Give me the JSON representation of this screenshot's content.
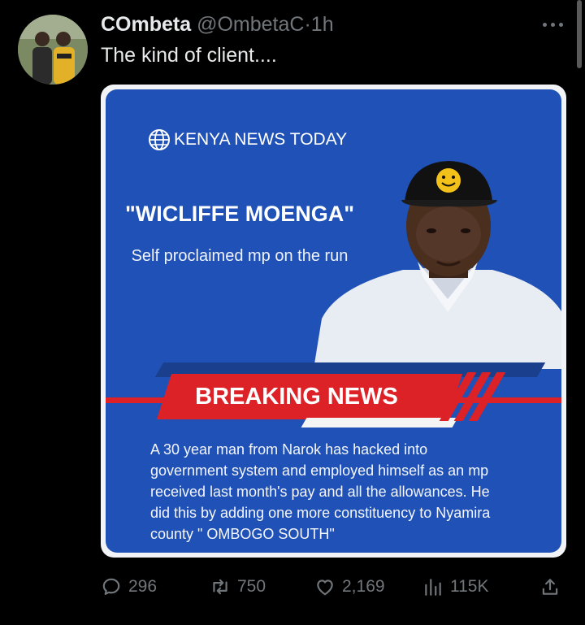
{
  "tweet": {
    "display_name": "COmbeta",
    "handle": "@OmbetaC",
    "separator": "·",
    "time": "1h",
    "text": "The kind of client...."
  },
  "media": {
    "brand": "KENYA NEWS TODAY",
    "headline": "\"WICLIFFE MOENGA\"",
    "subheadline": "Self proclaimed mp on the run",
    "banner": "BREAKING NEWS",
    "body_lines": [
      "A 30 year man from Narok has hacked into",
      "government system and employed himself as an mp",
      "received last month's pay and all the allowances. He",
      "did this by adding one more constituency to Nyamira",
      "county \" OMBOGO SOUTH\""
    ]
  },
  "actions": {
    "replies": "296",
    "reposts": "750",
    "likes": "2,169",
    "views": "115K"
  },
  "icons": [
    "more-icon",
    "globe-icon",
    "reply-icon",
    "repost-icon",
    "like-icon",
    "views-icon",
    "share-icon"
  ],
  "colors": {
    "card_blue": "#1f51b6",
    "breaking_red": "#dc2127",
    "muted_text": "#71767b"
  }
}
